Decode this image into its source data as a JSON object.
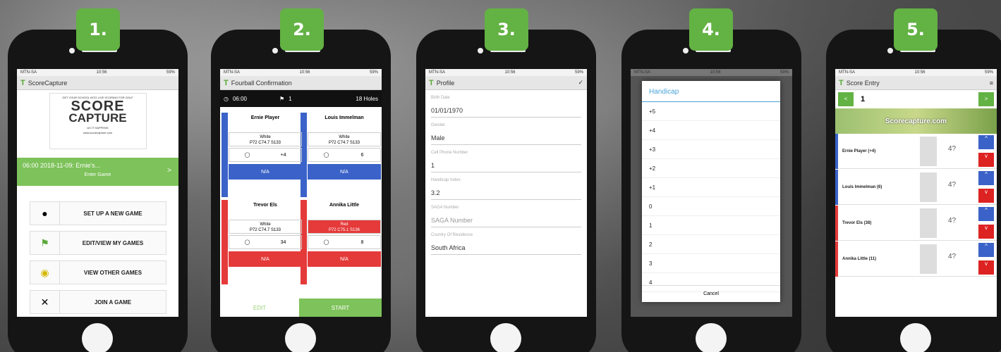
{
  "steps": [
    "1.",
    "2.",
    "3.",
    "4.",
    "5."
  ],
  "status": {
    "carrier": "MTN-SA",
    "time": "10:56",
    "battery": "59%"
  },
  "s1": {
    "title": "ScoreCapture",
    "logo_tag": "GET YOUR SCHOOL INTO LIVE SCORING FOR GOLF",
    "logo_score": "SCORE",
    "logo_capture": "CAPTURE",
    "logo_sub": "AS IT HAPPENS",
    "logo_url": "www.scorecapture.com",
    "game": "06:00 2018-11-09: Ernie's...",
    "enter": "Enter Game",
    "menu": [
      "SET UP A NEW GAME",
      "EDIT/VIEW MY GAMES",
      "VIEW OTHER GAMES",
      "JOIN A GAME"
    ]
  },
  "s2": {
    "title": "Fourball Confirmation",
    "time": "06:00",
    "hole": "1",
    "holes": "18 Holes",
    "players": [
      {
        "name": "Ernie Player",
        "tee": "White",
        "detail": "P72 C74.7 S133",
        "hc": "+4",
        "na": "N/A"
      },
      {
        "name": "Louis Immelman",
        "tee": "White",
        "detail": "P72 C74.7 S133",
        "hc": "6",
        "na": "N/A"
      },
      {
        "name": "Trevor Els",
        "tee": "White",
        "detail": "P72 C74.7 S133",
        "hc": "34",
        "na": "N/A"
      },
      {
        "name": "Annika Little",
        "tee": "Red",
        "detail": "P72 C75.1 S136",
        "hc": "8",
        "na": "N/A"
      }
    ],
    "edit": "EDIT",
    "start": "START"
  },
  "s3": {
    "title": "Profile",
    "fields": [
      {
        "label": "Birth Date",
        "value": "01/01/1970"
      },
      {
        "label": "Gender",
        "value": "Male"
      },
      {
        "label": "Cell Phone Number",
        "value": "1"
      },
      {
        "label": "Handicap Index",
        "value": "3.2"
      },
      {
        "label": "SAGA Number",
        "value": "SAGA Number"
      },
      {
        "label": "Country Of Residence",
        "value": "South Africa"
      }
    ]
  },
  "s4": {
    "title": "Handicap",
    "options": [
      "+5",
      "+4",
      "+3",
      "+2",
      "+1",
      "0",
      "1",
      "2",
      "3",
      "4"
    ],
    "cancel": "Cancel"
  },
  "s5": {
    "title": "Score Entry",
    "hole": "1",
    "banner": "Scorecapture.com",
    "rows": [
      {
        "name": "Ernie Player (+4)",
        "score": "4?"
      },
      {
        "name": "Louis Immelman (6)",
        "score": "4?"
      },
      {
        "name": "Trevor Els (38)",
        "score": "4?"
      },
      {
        "name": "Annika Little (11)",
        "score": "4?"
      }
    ]
  },
  "colors": {
    "green": "#63b244",
    "blue": "#3a62c8",
    "red": "#e53a3a"
  }
}
